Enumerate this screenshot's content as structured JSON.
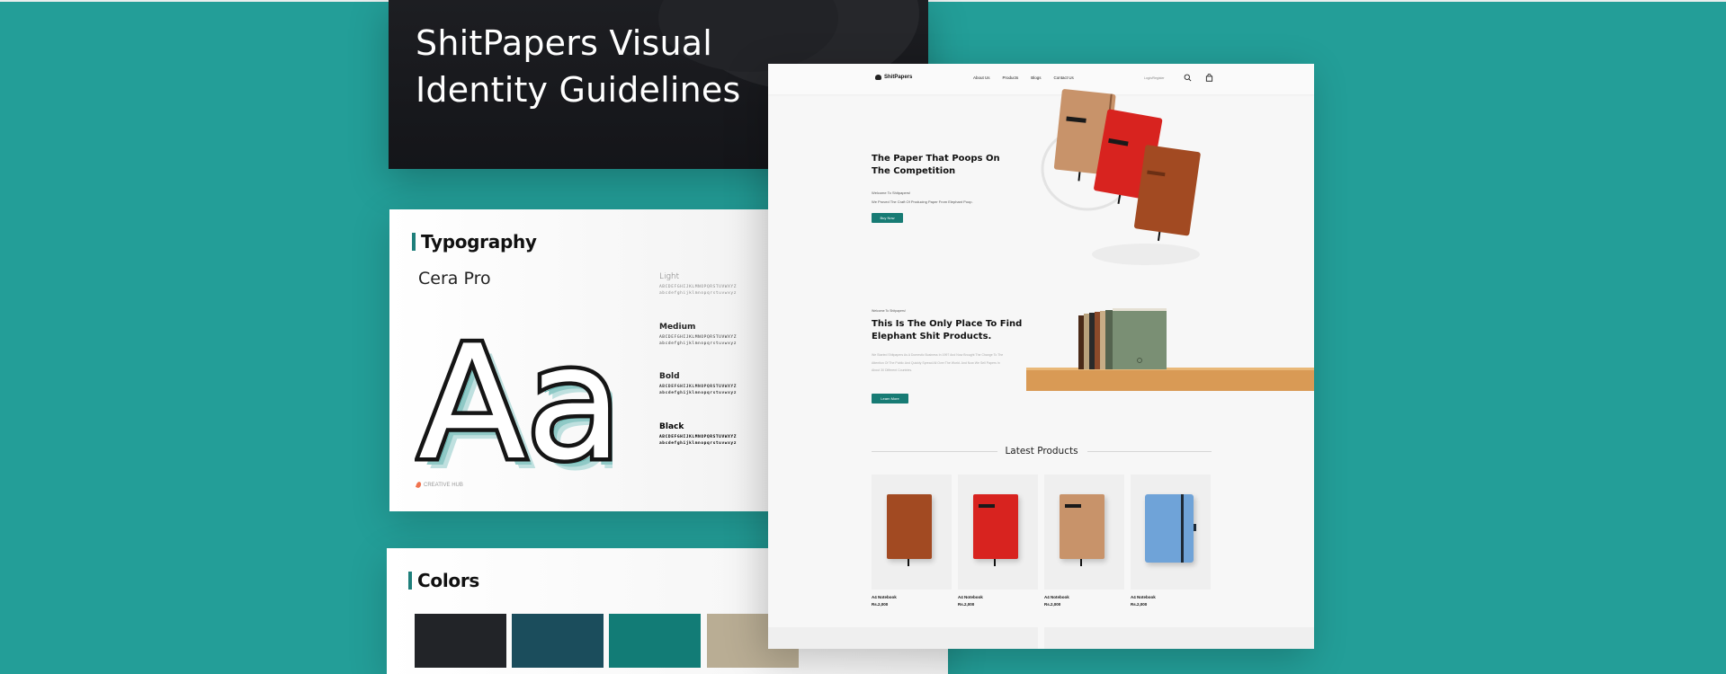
{
  "title_card": {
    "title": "ShitPapers Visual Identity Guidelines"
  },
  "typography": {
    "heading": "Typography",
    "font_name": "Cera Pro",
    "specimen": "Aa",
    "weights": [
      {
        "name": "Light",
        "upper": "ABCDEFGHIJKLMNOPQRSTUVWXYZ",
        "lower": "abcdefghijklmnopqrstuvwxyz"
      },
      {
        "name": "Medium",
        "upper": "ABCDEFGHIJKLMNOPQRSTUVWXYZ",
        "lower": "abcdefghijklmnopqrstuvwxyz"
      },
      {
        "name": "Bold",
        "upper": "ABCDEFGHIJKLMNOPQRSTUVWXYZ",
        "lower": "abcdefghijklmnopqrstuvwxyz"
      },
      {
        "name": "Black",
        "upper": "ABCDEFGHIJKLMNOPQRSTUVWXYZ",
        "lower": "abcdefghijklmnopqrstuvwxyz"
      }
    ],
    "brand_mark": "CREATIVE HUB"
  },
  "colors": {
    "heading": "Colors",
    "swatches": [
      "#222428",
      "#1b4d5c",
      "#127c76",
      "#b9ad94"
    ]
  },
  "website": {
    "logo": "ShitPapers",
    "nav": [
      "About Us",
      "Products",
      "Blogs",
      "Contact Us"
    ],
    "login": "Login/Register",
    "hero": {
      "title": "The Paper That Poops On The Competition",
      "subtitle_line1": "Welcome To Shitpapers!",
      "subtitle_line2": "We Proved The Craft Of Producing Paper From Elephant Poop.",
      "button": "Buy Now"
    },
    "about": {
      "eyebrow": "Welcome To Shitpapers!",
      "title": "This Is The Only Place To Find Elephant Shit Products.",
      "body": "We Started Shitpapers As A Domestic Business In 1997 And Now Brought The Change To The Attention Of The Public And Quickly Spread All Over The World. And Now We Sell Papers In About 30 Different Countries.",
      "button": "Learn More"
    },
    "latest_heading": "Latest Products",
    "products": [
      {
        "name": "A4 Notebook",
        "price": "Rs.2,000",
        "cover": "#a24a22"
      },
      {
        "name": "A4 Notebook",
        "price": "Rs.2,000",
        "cover": "#d8231f"
      },
      {
        "name": "A4 Notebook",
        "price": "Rs.2,000",
        "cover": "#c8936a"
      },
      {
        "name": "A4 Notebook",
        "price": "Rs.2,000",
        "cover": "#6fa3d8"
      }
    ]
  },
  "theme": {
    "background": "#239e98",
    "accent": "#177b74"
  }
}
